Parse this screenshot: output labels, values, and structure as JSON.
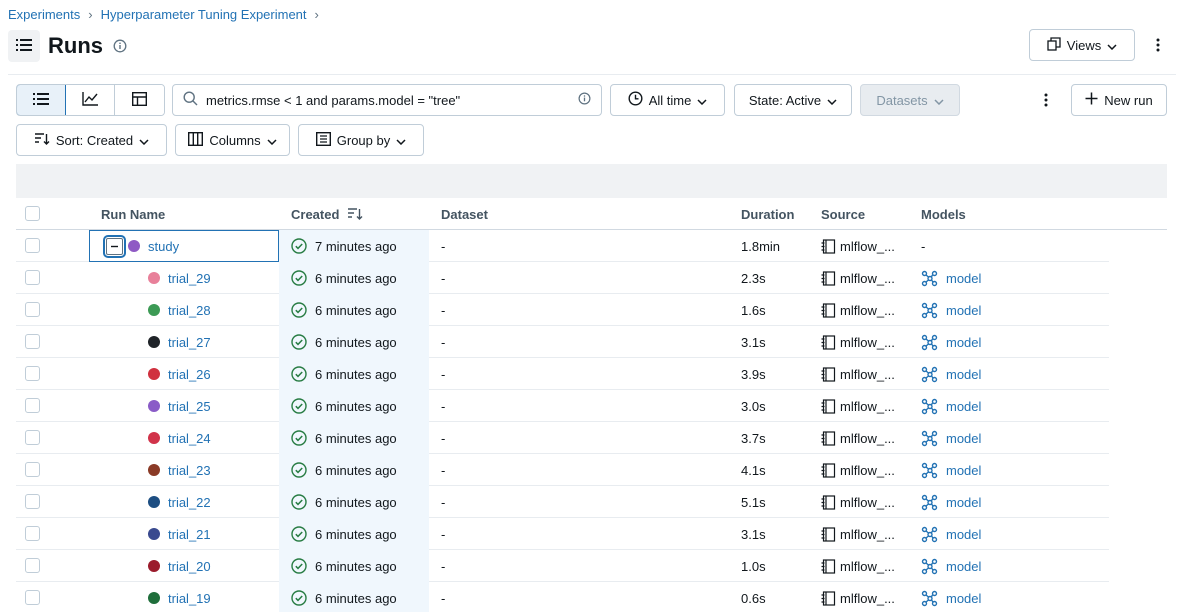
{
  "breadcrumb": {
    "items": [
      "Experiments",
      "Hyperparameter Tuning Experiment"
    ],
    "separator": "›"
  },
  "page": {
    "title": "Runs"
  },
  "header": {
    "views_label": "Views"
  },
  "toolbar": {
    "search_value": "metrics.rmse < 1 and params.model = \"tree\"",
    "time_filter": "All time",
    "state_filter": "State: Active",
    "datasets_label": "Datasets",
    "new_run_label": "New run",
    "sort_label": "Sort: Created",
    "columns_label": "Columns",
    "group_by_label": "Group by"
  },
  "table": {
    "columns": [
      "Run Name",
      "Created",
      "Dataset",
      "Duration",
      "Source",
      "Models"
    ],
    "parent": {
      "name": "study",
      "color": "#8f5ac4",
      "created": "7 minutes ago",
      "dataset": "-",
      "duration": "1.8min",
      "source": "mlflow_...",
      "models": "-"
    },
    "rows": [
      {
        "name": "trial_29",
        "color": "#e8809a",
        "created": "6 minutes ago",
        "dataset": "-",
        "duration": "2.3s",
        "source": "mlflow_...",
        "models": "model"
      },
      {
        "name": "trial_28",
        "color": "#3c9a55",
        "created": "6 minutes ago",
        "dataset": "-",
        "duration": "1.6s",
        "source": "mlflow_...",
        "models": "model"
      },
      {
        "name": "trial_27",
        "color": "#1f2328",
        "created": "6 minutes ago",
        "dataset": "-",
        "duration": "3.1s",
        "source": "mlflow_...",
        "models": "model"
      },
      {
        "name": "trial_26",
        "color": "#d0313f",
        "created": "6 minutes ago",
        "dataset": "-",
        "duration": "3.9s",
        "source": "mlflow_...",
        "models": "model"
      },
      {
        "name": "trial_25",
        "color": "#8a5cc7",
        "created": "6 minutes ago",
        "dataset": "-",
        "duration": "3.0s",
        "source": "mlflow_...",
        "models": "model"
      },
      {
        "name": "trial_24",
        "color": "#d1334a",
        "created": "6 minutes ago",
        "dataset": "-",
        "duration": "3.7s",
        "source": "mlflow_...",
        "models": "model"
      },
      {
        "name": "trial_23",
        "color": "#8a3a26",
        "created": "6 minutes ago",
        "dataset": "-",
        "duration": "4.1s",
        "source": "mlflow_...",
        "models": "model"
      },
      {
        "name": "trial_22",
        "color": "#1d4e82",
        "created": "6 minutes ago",
        "dataset": "-",
        "duration": "5.1s",
        "source": "mlflow_...",
        "models": "model"
      },
      {
        "name": "trial_21",
        "color": "#3a4a8f",
        "created": "6 minutes ago",
        "dataset": "-",
        "duration": "3.1s",
        "source": "mlflow_...",
        "models": "model"
      },
      {
        "name": "trial_20",
        "color": "#9b1c2c",
        "created": "6 minutes ago",
        "dataset": "-",
        "duration": "1.0s",
        "source": "mlflow_...",
        "models": "model"
      },
      {
        "name": "trial_19",
        "color": "#1f6e3b",
        "created": "6 minutes ago",
        "dataset": "-",
        "duration": "0.6s",
        "source": "mlflow_...",
        "models": "model"
      }
    ]
  },
  "colors": {
    "accent": "#2272b4",
    "success": "#277c43",
    "model_icon": "#2272b4"
  },
  "icons": [
    "menu-icon",
    "info-icon",
    "copy-icon",
    "chevron-down-icon",
    "kebab-icon",
    "list-view-icon",
    "chart-view-icon",
    "table-view-icon",
    "search-icon",
    "clock-icon",
    "plus-icon",
    "sort-icon",
    "columns-icon",
    "group-icon",
    "collapse-icon",
    "check-circle-icon",
    "notebook-icon",
    "model-icon"
  ]
}
